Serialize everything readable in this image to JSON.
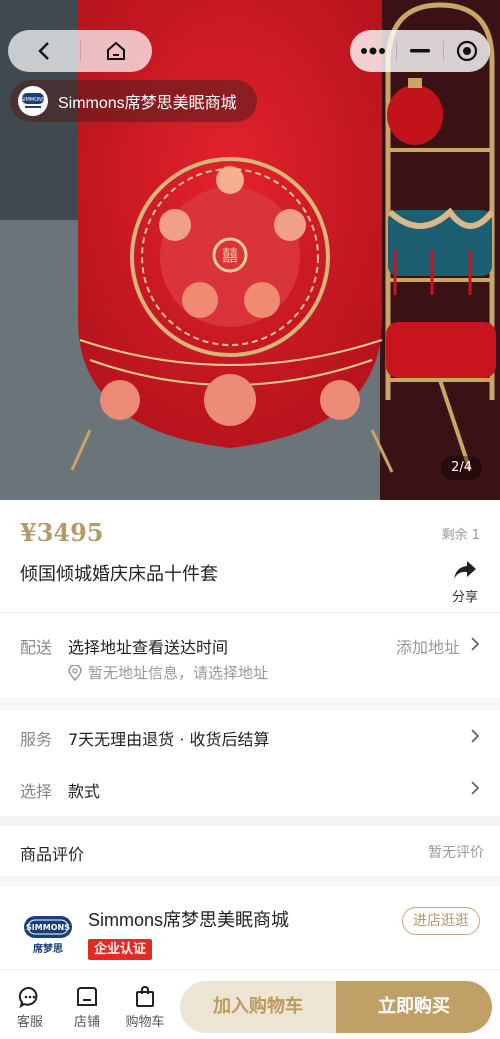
{
  "top_nav": {
    "back_icon": "chevron-left-icon",
    "home_icon": "home-icon",
    "more_icon": "more-dots-icon",
    "minimize_icon": "minus-icon",
    "close_icon": "target-icon"
  },
  "store_pill": {
    "name": "Simmons席梦思美眠商城"
  },
  "gallery": {
    "indicator": "2/4",
    "current": 2,
    "total": 4
  },
  "product": {
    "price": "¥3495",
    "stock": "剩余 1",
    "title": "倾国倾城婚庆床品十件套",
    "share_label": "分享"
  },
  "delivery": {
    "label": "配送",
    "value": "选择地址查看送达时间",
    "action": "添加地址",
    "hint": "暂无地址信息，请选择地址"
  },
  "service": {
    "label": "服务",
    "value": "7天无理由退货 · 收货后结算"
  },
  "select": {
    "label": "选择",
    "value": "款式"
  },
  "reviews": {
    "title": "商品评价",
    "status": "暂无评价"
  },
  "shop": {
    "name": "Simmons席梦思美眠商城",
    "badge": "企业认证",
    "visit_label": "进店逛逛",
    "logo_text": "席梦思"
  },
  "bottom_bar": {
    "tabs": [
      {
        "label": "客服",
        "icon": "chat-icon"
      },
      {
        "label": "店铺",
        "icon": "shop-icon"
      },
      {
        "label": "购物车",
        "icon": "shopping-bag-icon"
      }
    ],
    "add_to_cart": "加入购物车",
    "buy_now": "立即购买"
  },
  "colors": {
    "accent_gold": "#c0a066",
    "price": "#b59a6a",
    "badge_red": "#e52a23",
    "hero_red": "#d0202a"
  }
}
